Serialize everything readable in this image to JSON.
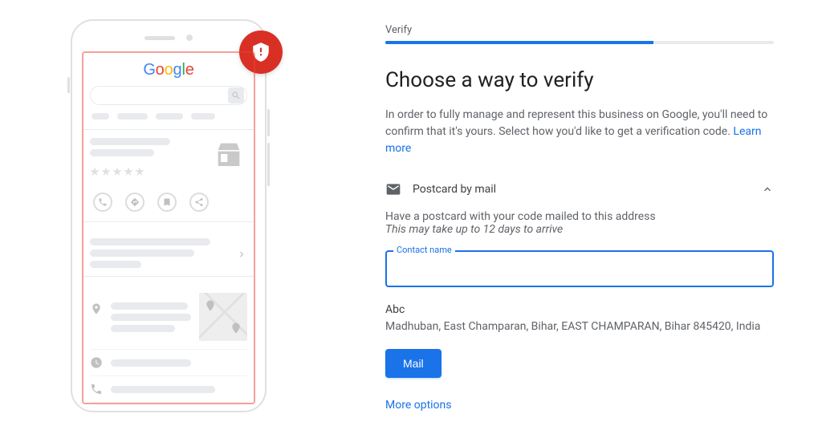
{
  "step_label": "Verify",
  "heading": "Choose a way to verify",
  "description": "In order to fully manage and represent this business on Google, you'll need to confirm that it's yours. Select how you'd like to get a verification code. ",
  "learn_more": "Learn more",
  "method": {
    "label": "Postcard by mail",
    "sub1": "Have a postcard with your code mailed to this address",
    "sub2": "This may take up to 12 days to arrive"
  },
  "field": {
    "label": "Contact name",
    "value": ""
  },
  "business": {
    "name": "Abc",
    "address": "Madhuban, East Champaran, Bihar, EAST CHAMPARAN, Bihar 845420, India"
  },
  "buttons": {
    "mail": "Mail",
    "more": "More options"
  },
  "logo_letters": {
    "G": "G",
    "o1": "o",
    "o2": "o",
    "g": "g",
    "l": "l",
    "e": "e"
  }
}
